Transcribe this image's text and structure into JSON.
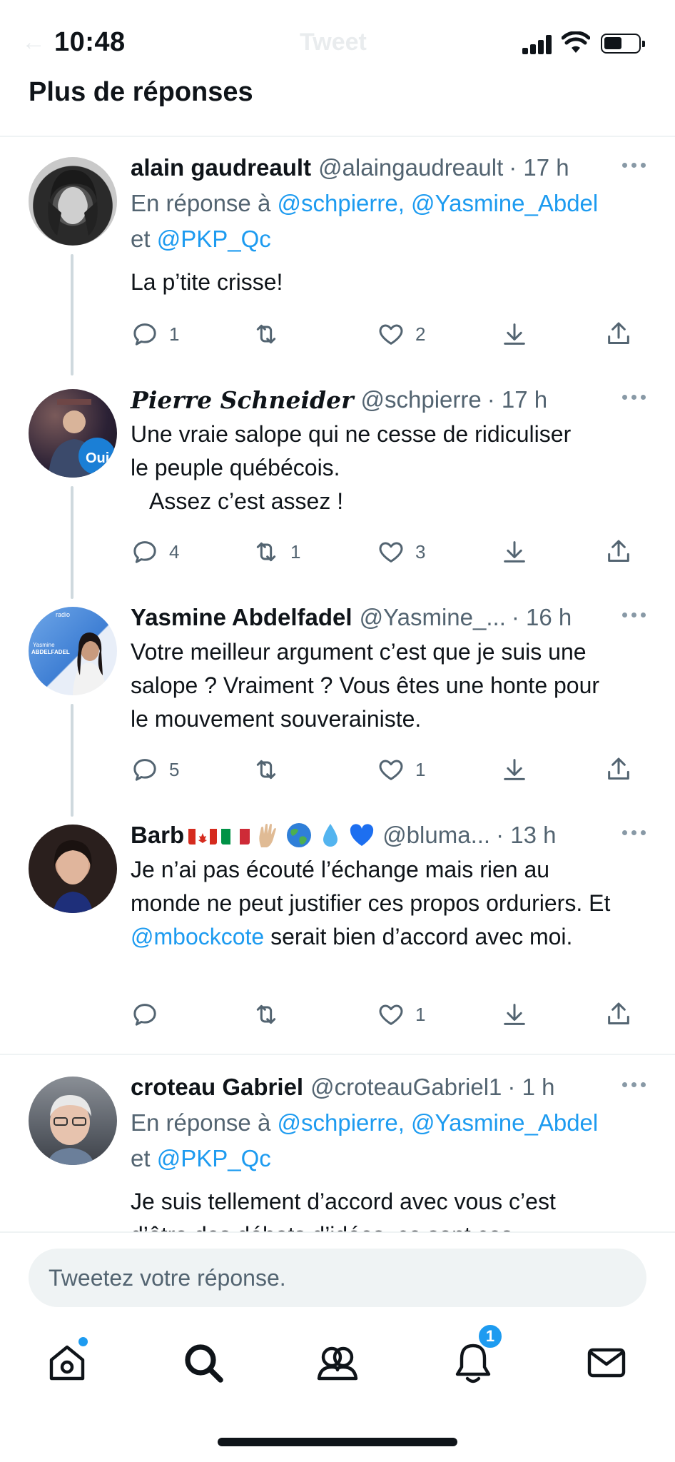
{
  "status_bar": {
    "time": "10:48"
  },
  "ghost_header": {
    "title": "Tweet"
  },
  "section_title": "Plus de réponses",
  "tweets": [
    {
      "name": "alain gaudreault",
      "handle": "@alaingaudreault",
      "time": "· 17 h",
      "reply_prefix": "En réponse à ",
      "reply_mentions_1": "@schpierre, @Yasmine_Abdel",
      "reply_connector": "et ",
      "reply_mentions_2": "@PKP_Qc",
      "text": "La p’tite crisse!",
      "replies": "1",
      "retweets": "",
      "likes": "2"
    },
    {
      "name": "Pierre Schneider",
      "handle": "@schpierre",
      "time": "· 17 h",
      "text_line1": "Une vraie salope qui ne cesse de ridiculiser",
      "text_line2": "le peuple québécois.",
      "text_line3": "Assez c’est assez !",
      "avatar_badge": "Oui",
      "replies": "4",
      "retweets": "1",
      "likes": "3"
    },
    {
      "name": "Yasmine Abdelfadel",
      "handle": "@Yasmine_...",
      "time": "· 16 h",
      "text": "Votre meilleur argument c’est que je suis une salope ? Vraiment ? Vous êtes une honte pour le mouvement souverainiste.",
      "avatar_text_1": "radio",
      "avatar_text_2": "Yasmine",
      "avatar_text_3": "ABDELFADEL",
      "replies": "5",
      "retweets": "",
      "likes": "1"
    },
    {
      "name": "Barb",
      "handle": "@bluma...",
      "time": "· 13 h",
      "text_before": "Je n’ai pas écouté l’échange mais rien au monde ne peut justifier ces propos orduriers. Et ",
      "mention": "@mbockcote",
      "text_after": " serait bien d’accord avec moi.",
      "replies": "",
      "retweets": "",
      "likes": "1"
    },
    {
      "name": "croteau Gabriel",
      "handle": "@croteauGabriel1",
      "time": "· 1 h",
      "reply_prefix": "En réponse à ",
      "reply_mentions_1": "@schpierre, @Yasmine_Abdel",
      "reply_connector": "et ",
      "reply_mentions_2": "@PKP_Qc",
      "text_line1": "Je suis tellement d’accord avec vous c’est",
      "text_line2": "d’être des débats d’idées, ce sont ces"
    }
  ],
  "reply_box": {
    "placeholder": "Tweetez votre réponse."
  },
  "nav": {
    "notifications_badge": "1"
  },
  "icons": {
    "reply": "reply-icon",
    "retweet": "retweet-icon",
    "like": "heart-icon",
    "bookmark": "bookmark-download-icon",
    "share": "share-icon",
    "more": "more-icon"
  },
  "colors": {
    "accent": "#1d9bf0",
    "text": "#0f1419",
    "muted": "#536471",
    "thread": "#cfd9de"
  }
}
